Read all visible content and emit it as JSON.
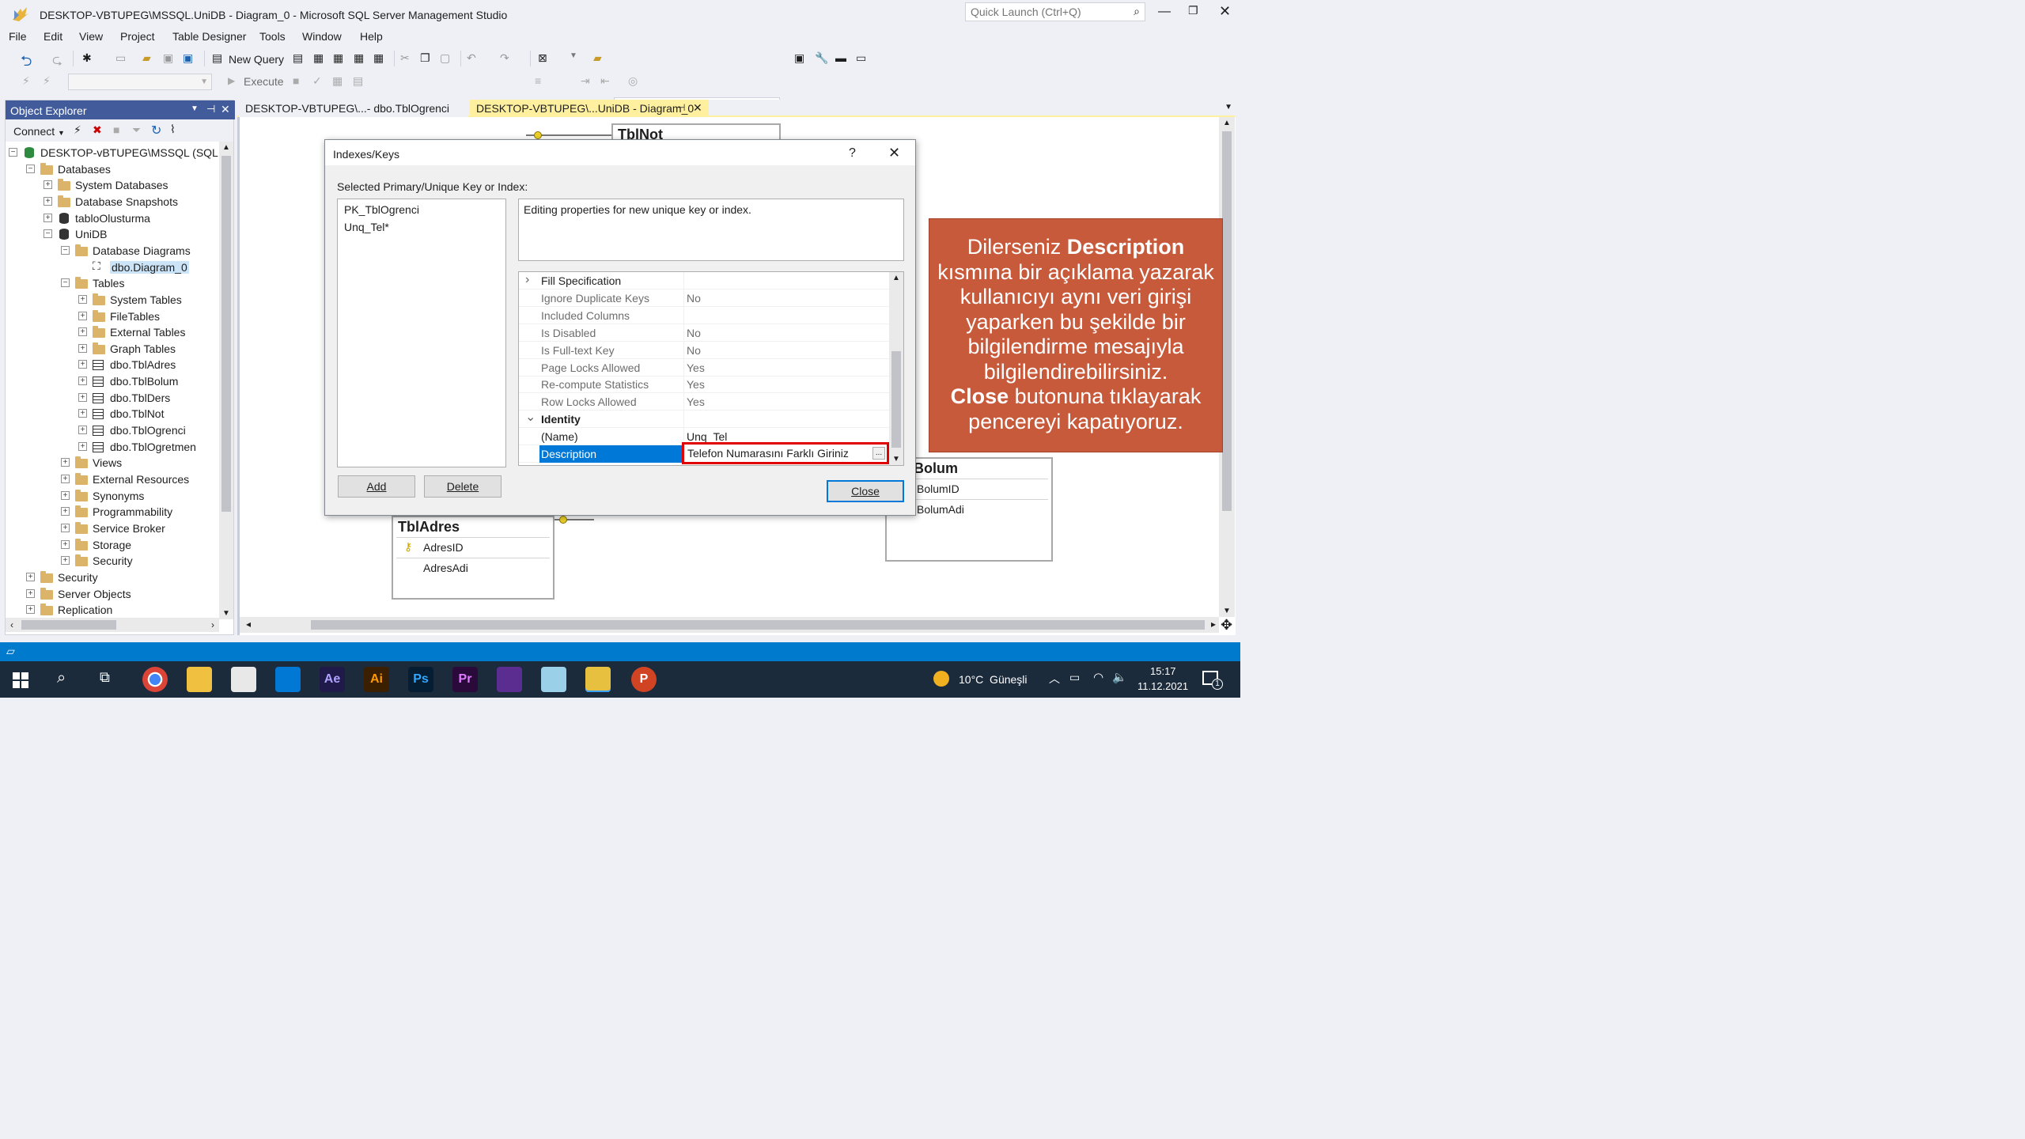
{
  "window": {
    "title": "DESKTOP-VBTUPEG\\MSSQL.UniDB - Diagram_0 - Microsoft SQL Server Management Studio"
  },
  "quick_launch": {
    "placeholder": "Quick Launch (Ctrl+Q)"
  },
  "menu": [
    "File",
    "Edit",
    "View",
    "Project",
    "Table Designer",
    "Tools",
    "Window",
    "Help"
  ],
  "toolbar": {
    "new_query": "New Query",
    "execute": "Execute"
  },
  "object_explorer": {
    "title": "Object Explorer",
    "connect": "Connect",
    "tree": [
      {
        "label": "DESKTOP-vBTUPEG\\MSSQL (SQL Ser"
      },
      {
        "label": "Databases"
      },
      {
        "label": "System Databases"
      },
      {
        "label": "Database Snapshots"
      },
      {
        "label": "tabloOlusturma"
      },
      {
        "label": "UniDB"
      },
      {
        "label": "Database Diagrams"
      },
      {
        "label": "dbo.Diagram_0"
      },
      {
        "label": "Tables"
      },
      {
        "label": "System Tables"
      },
      {
        "label": "FileTables"
      },
      {
        "label": "External Tables"
      },
      {
        "label": "Graph Tables"
      },
      {
        "label": "dbo.TblAdres"
      },
      {
        "label": "dbo.TblBolum"
      },
      {
        "label": "dbo.TblDers"
      },
      {
        "label": "dbo.TblNot"
      },
      {
        "label": "dbo.TblOgrenci"
      },
      {
        "label": "dbo.TblOgretmen"
      },
      {
        "label": "Views"
      },
      {
        "label": "External Resources"
      },
      {
        "label": "Synonyms"
      },
      {
        "label": "Programmability"
      },
      {
        "label": "Service Broker"
      },
      {
        "label": "Storage"
      },
      {
        "label": "Security"
      },
      {
        "label": "Security"
      },
      {
        "label": "Server Objects"
      },
      {
        "label": "Replication"
      }
    ]
  },
  "tabs": [
    {
      "label": "DESKTOP-VBTUPEG\\...- dbo.TblOgrenci"
    },
    {
      "label": "DESKTOP-VBTUPEG\\...UniDB - Diagram_0"
    }
  ],
  "diagram": {
    "tblnot": "TblNot",
    "tbladres": {
      "name": "TblAdres",
      "cols": [
        "AdresID",
        "AdresAdi"
      ]
    },
    "tblbolum": {
      "name": "Bolum",
      "cols": [
        "BolumID",
        "BolumAdi"
      ]
    }
  },
  "dialog": {
    "title": "Indexes/Keys",
    "help": "?",
    "selected_label": "Selected Primary/Unique Key or Index:",
    "keys": [
      "PK_TblOgrenci",
      "Unq_Tel*"
    ],
    "info": "Editing properties for new unique key or index.",
    "props": [
      {
        "name": "Fill Specification",
        "value": "",
        "category": true,
        "expanded": false
      },
      {
        "name": "Ignore Duplicate Keys",
        "value": "No"
      },
      {
        "name": "Included Columns",
        "value": ""
      },
      {
        "name": "Is Disabled",
        "value": "No"
      },
      {
        "name": "Is Full-text Key",
        "value": "No"
      },
      {
        "name": "Page Locks Allowed",
        "value": "Yes"
      },
      {
        "name": "Re-compute Statistics",
        "value": "Yes"
      },
      {
        "name": "Row Locks Allowed",
        "value": "Yes"
      },
      {
        "name": "Identity",
        "value": "",
        "category": true,
        "expanded": true
      },
      {
        "name": "(Name)",
        "value": "Unq_Tel"
      },
      {
        "name": "Description",
        "value": "Telefon Numarasını Farklı Giriniz",
        "selected": true
      }
    ],
    "ellipsis": "...",
    "add": "Add",
    "delete": "Delete",
    "close": "Close"
  },
  "callout": {
    "l1a": "Dilerseniz ",
    "l1b": "Description",
    "l2": "kısmına bir açıklama yazarak",
    "l3": "kullanıcıyı aynı veri girişi",
    "l4": "yaparken bu şekilde bir",
    "l5": "bilgilendirme mesajıyla",
    "l6": "bilgilendirebilirsiniz.",
    "l7a": "Close",
    "l7b": " butonuna tıklayarak",
    "l8": "pencereyi kapatıyoruz."
  },
  "taskbar": {
    "weather": "10°C  Güneşli",
    "time": "15:17",
    "date": "11.12.2021",
    "notif_count": "1",
    "apps": [
      "Ae",
      "Ai",
      "Ps",
      "Pr"
    ]
  },
  "colors": {
    "accent": "#007acc",
    "selection": "#0078d7",
    "callout": "#c85a3c",
    "highlight_box": "#e00000",
    "oe_header": "#425c9b"
  }
}
